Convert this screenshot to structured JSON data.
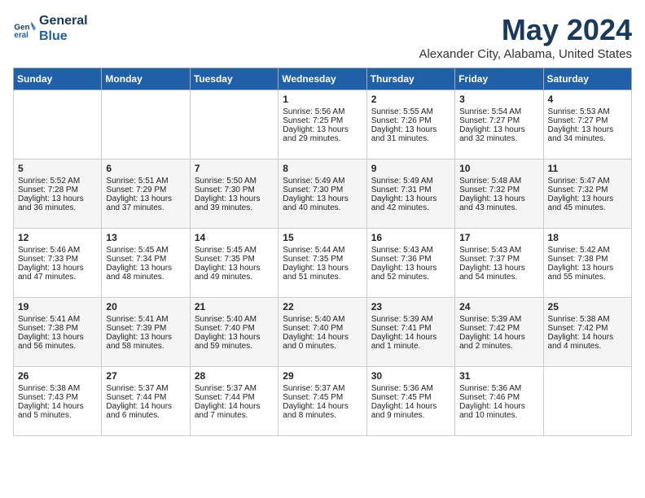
{
  "header": {
    "logo_line1": "General",
    "logo_line2": "Blue",
    "month": "May 2024",
    "location": "Alexander City, Alabama, United States"
  },
  "days_of_week": [
    "Sunday",
    "Monday",
    "Tuesday",
    "Wednesday",
    "Thursday",
    "Friday",
    "Saturday"
  ],
  "weeks": [
    [
      {
        "day": "",
        "empty": true
      },
      {
        "day": "",
        "empty": true
      },
      {
        "day": "",
        "empty": true
      },
      {
        "day": "1",
        "sunrise": "5:56 AM",
        "sunset": "7:25 PM",
        "daylight": "13 hours and 29 minutes."
      },
      {
        "day": "2",
        "sunrise": "5:55 AM",
        "sunset": "7:26 PM",
        "daylight": "13 hours and 31 minutes."
      },
      {
        "day": "3",
        "sunrise": "5:54 AM",
        "sunset": "7:27 PM",
        "daylight": "13 hours and 32 minutes."
      },
      {
        "day": "4",
        "sunrise": "5:53 AM",
        "sunset": "7:27 PM",
        "daylight": "13 hours and 34 minutes."
      }
    ],
    [
      {
        "day": "5",
        "sunrise": "5:52 AM",
        "sunset": "7:28 PM",
        "daylight": "13 hours and 36 minutes."
      },
      {
        "day": "6",
        "sunrise": "5:51 AM",
        "sunset": "7:29 PM",
        "daylight": "13 hours and 37 minutes."
      },
      {
        "day": "7",
        "sunrise": "5:50 AM",
        "sunset": "7:30 PM",
        "daylight": "13 hours and 39 minutes."
      },
      {
        "day": "8",
        "sunrise": "5:49 AM",
        "sunset": "7:30 PM",
        "daylight": "13 hours and 40 minutes."
      },
      {
        "day": "9",
        "sunrise": "5:49 AM",
        "sunset": "7:31 PM",
        "daylight": "13 hours and 42 minutes."
      },
      {
        "day": "10",
        "sunrise": "5:48 AM",
        "sunset": "7:32 PM",
        "daylight": "13 hours and 43 minutes."
      },
      {
        "day": "11",
        "sunrise": "5:47 AM",
        "sunset": "7:32 PM",
        "daylight": "13 hours and 45 minutes."
      }
    ],
    [
      {
        "day": "12",
        "sunrise": "5:46 AM",
        "sunset": "7:33 PM",
        "daylight": "13 hours and 47 minutes."
      },
      {
        "day": "13",
        "sunrise": "5:45 AM",
        "sunset": "7:34 PM",
        "daylight": "13 hours and 48 minutes."
      },
      {
        "day": "14",
        "sunrise": "5:45 AM",
        "sunset": "7:35 PM",
        "daylight": "13 hours and 49 minutes."
      },
      {
        "day": "15",
        "sunrise": "5:44 AM",
        "sunset": "7:35 PM",
        "daylight": "13 hours and 51 minutes."
      },
      {
        "day": "16",
        "sunrise": "5:43 AM",
        "sunset": "7:36 PM",
        "daylight": "13 hours and 52 minutes."
      },
      {
        "day": "17",
        "sunrise": "5:43 AM",
        "sunset": "7:37 PM",
        "daylight": "13 hours and 54 minutes."
      },
      {
        "day": "18",
        "sunrise": "5:42 AM",
        "sunset": "7:38 PM",
        "daylight": "13 hours and 55 minutes."
      }
    ],
    [
      {
        "day": "19",
        "sunrise": "5:41 AM",
        "sunset": "7:38 PM",
        "daylight": "13 hours and 56 minutes."
      },
      {
        "day": "20",
        "sunrise": "5:41 AM",
        "sunset": "7:39 PM",
        "daylight": "13 hours and 58 minutes."
      },
      {
        "day": "21",
        "sunrise": "5:40 AM",
        "sunset": "7:40 PM",
        "daylight": "13 hours and 59 minutes."
      },
      {
        "day": "22",
        "sunrise": "5:40 AM",
        "sunset": "7:40 PM",
        "daylight": "14 hours and 0 minutes."
      },
      {
        "day": "23",
        "sunrise": "5:39 AM",
        "sunset": "7:41 PM",
        "daylight": "14 hours and 1 minute."
      },
      {
        "day": "24",
        "sunrise": "5:39 AM",
        "sunset": "7:42 PM",
        "daylight": "14 hours and 2 minutes."
      },
      {
        "day": "25",
        "sunrise": "5:38 AM",
        "sunset": "7:42 PM",
        "daylight": "14 hours and 4 minutes."
      }
    ],
    [
      {
        "day": "26",
        "sunrise": "5:38 AM",
        "sunset": "7:43 PM",
        "daylight": "14 hours and 5 minutes."
      },
      {
        "day": "27",
        "sunrise": "5:37 AM",
        "sunset": "7:44 PM",
        "daylight": "14 hours and 6 minutes."
      },
      {
        "day": "28",
        "sunrise": "5:37 AM",
        "sunset": "7:44 PM",
        "daylight": "14 hours and 7 minutes."
      },
      {
        "day": "29",
        "sunrise": "5:37 AM",
        "sunset": "7:45 PM",
        "daylight": "14 hours and 8 minutes."
      },
      {
        "day": "30",
        "sunrise": "5:36 AM",
        "sunset": "7:45 PM",
        "daylight": "14 hours and 9 minutes."
      },
      {
        "day": "31",
        "sunrise": "5:36 AM",
        "sunset": "7:46 PM",
        "daylight": "14 hours and 10 minutes."
      },
      {
        "day": "",
        "empty": true
      }
    ]
  ],
  "labels": {
    "sunrise": "Sunrise:",
    "sunset": "Sunset:",
    "daylight": "Daylight:"
  }
}
